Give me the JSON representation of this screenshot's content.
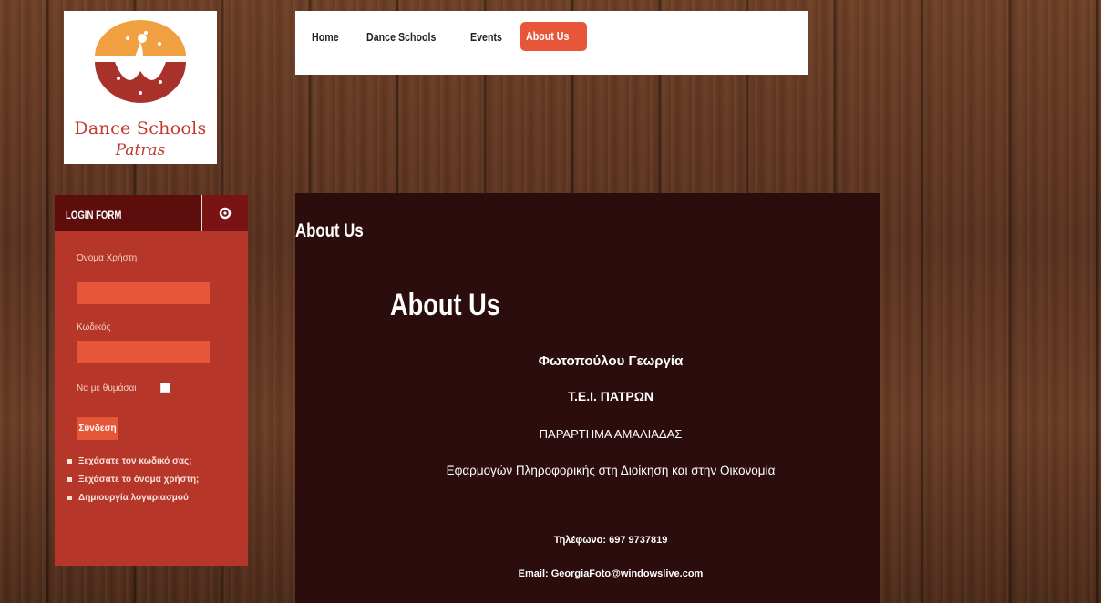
{
  "logo": {
    "line1": "Dance Schools",
    "line2": "Patras"
  },
  "nav": {
    "items": [
      "Home",
      "Dance Schools",
      "Events"
    ],
    "active": "About Us"
  },
  "login": {
    "title": "LOGIN FORM",
    "settings_icon": "gear-icon",
    "username_label": "Όνομα Χρήστη",
    "username_value": "",
    "password_label": "Κωδικός",
    "password_value": "",
    "remember_label": "Να με θυμάσαι",
    "submit_label": "Σύνδεση",
    "links": [
      "Ξεχάσατε τον κωδικό σας;",
      "Ξεχάσατε το όνομα χρήστη;",
      "Δημιουργία λογαριασμού"
    ]
  },
  "page": {
    "title": "About Us",
    "article_title": "About Us",
    "name": "Φωτοπούλου Γεωργία",
    "institution": "Τ.Ε.Ι. ΠΑΤΡΩΝ",
    "branch": "ΠΑΡΑΡΤΗΜΑ ΑΜΑΛΙΑΔΑΣ",
    "department": "Εφαρμογών Πληροφορικής στη Διοίκηση και στην Οικονομία",
    "phone": "Τηλέφωνο:  697 9737819",
    "email": "Email: GeorgiaFoto@windowslive.com"
  },
  "colors": {
    "accent": "#e8563a",
    "panel": "#b6372a",
    "panel_header": "#5e0d0d",
    "content_bg": "#2c0d0d"
  }
}
